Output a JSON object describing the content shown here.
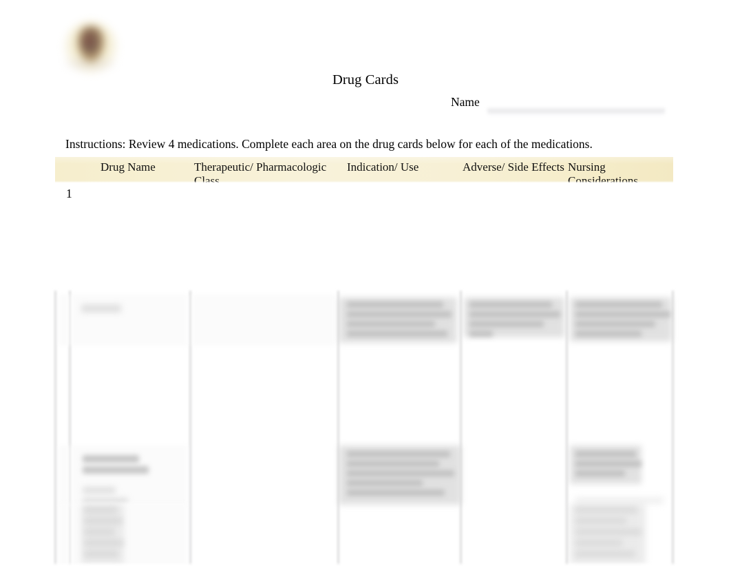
{
  "document": {
    "title": "Drug Cards",
    "name_label": "Name",
    "name_value": "",
    "instructions": "Instructions: Review 4 medications.  Complete each area on the drug cards below for each of the medications.",
    "logo_alt": "school-crest-logo"
  },
  "table": {
    "headers": [
      "Drug Name",
      "Therapeutic/ Pharmacologic Class",
      "Indication/ Use",
      "Adverse/ Side Effects",
      "Nursing Considerations"
    ],
    "header_line1": [
      "Drug Name",
      "Therapeutic/ Pharmacologic",
      "Indication/ Use",
      "Adverse/ Side Effects",
      "Nursing"
    ],
    "header_line2": [
      "",
      "Class",
      "",
      "",
      "Considerations"
    ],
    "rows": [
      {
        "number": "1",
        "drug_name": "",
        "therapeutic_class": "",
        "indication": "",
        "adverse_effects": "",
        "nursing_considerations": ""
      }
    ],
    "header_background": "#f6eecd"
  },
  "colors": {
    "page_background": "#ffffff",
    "text": "#000000",
    "header_band": "#f6eecd",
    "rule": "#d0d0d2"
  }
}
